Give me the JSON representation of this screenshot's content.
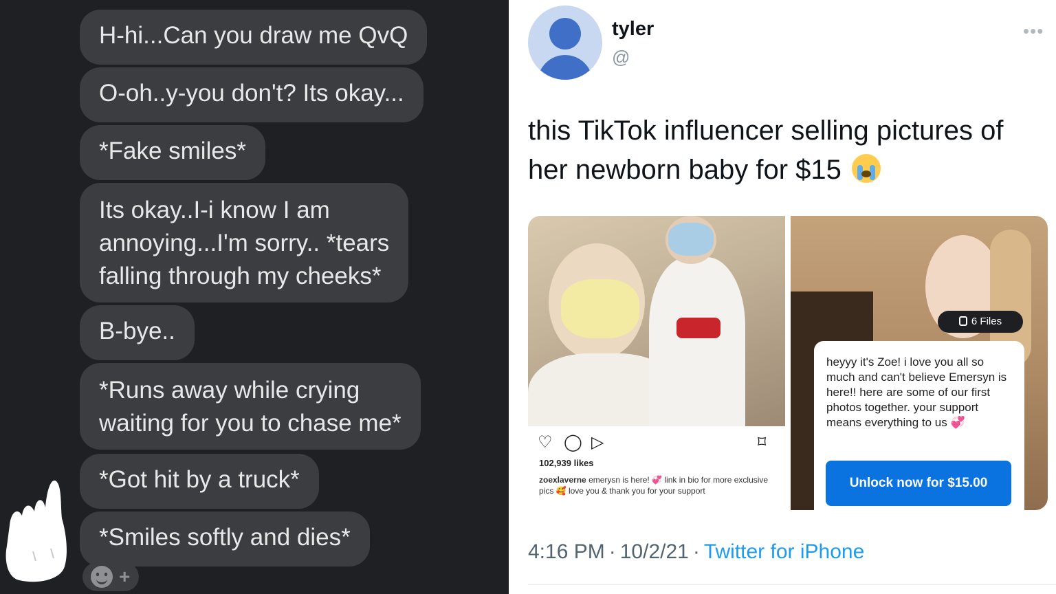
{
  "chat": {
    "messages": [
      {
        "lines": [
          "H-hi...Can you draw me QvQ"
        ]
      },
      {
        "lines": [
          "O-oh..y-you don't? Its okay..."
        ]
      },
      {
        "lines": [
          "*Fake smiles*"
        ]
      },
      {
        "lines": [
          "Its okay..I-i know I am",
          "annoying...I'm sorry.. *tears",
          "falling through my cheeks*"
        ]
      },
      {
        "lines": [
          "B-bye.."
        ]
      },
      {
        "lines": [
          "*Runs away while crying",
          "waiting for you to chase me*"
        ]
      },
      {
        "lines": [
          "*Got hit by a truck*"
        ]
      },
      {
        "lines": [
          "*Smiles softly and dies*"
        ]
      }
    ],
    "reaction_plus": "+",
    "colors": {
      "background": "#1e2024",
      "bubble": "#3b3d41",
      "text": "#e8e8e8"
    }
  },
  "tweet": {
    "display_name": "tyler",
    "handle": "@",
    "more_icon": "more-horizontal-icon",
    "more_label": "•••",
    "text": "this TikTok influencer selling pictures of her newborn baby for $15",
    "emoji": "loudly-crying-face-icon",
    "instagram": {
      "likes": "102,939 likes",
      "caption_user": "zoexlaverne",
      "caption_text": "emerysn is here! 💞 link in bio for more exclusive pics 🥰 love you & thank you for your support",
      "icons": {
        "like": "♡",
        "comment": "◯",
        "share": "▷",
        "save": "⌑"
      }
    },
    "onlyfans": {
      "files_badge": "6 Files",
      "message": "heyyy it's Zoe! i love you all so much and can't believe Emersyn is here!! here are some of our first photos together. your support means everything to us 💞",
      "unlock_button": "Unlock now for $15.00"
    },
    "time": "4:16 PM",
    "date": "10/2/21",
    "separator": "·",
    "source": "Twitter for iPhone",
    "colors": {
      "link": "#1d9bf0",
      "button": "#0a73e0",
      "meta": "#536471"
    }
  }
}
